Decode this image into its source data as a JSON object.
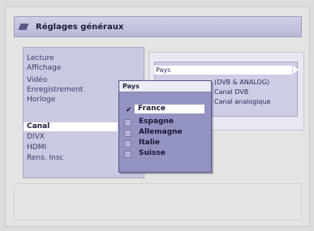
{
  "window": {
    "title": "Réglages généraux"
  },
  "sidebar": {
    "items": [
      {
        "label": "Lecture"
      },
      {
        "label": "Affichage"
      },
      {
        "label": "Vidéo"
      },
      {
        "label": "Enregistrement"
      },
      {
        "label": "Horloge"
      },
      {
        "label": "Canal"
      },
      {
        "label": "DIVX"
      },
      {
        "label": "HDMI"
      },
      {
        "label": "Rens. Insc"
      }
    ],
    "selected_index": 5
  },
  "panel": {
    "rows": [
      {
        "label": "Pays"
      },
      {
        "label": "(DVB & ANALOG)"
      },
      {
        "label": "Canal DVB"
      },
      {
        "label": "Canal analogique"
      }
    ]
  },
  "popup": {
    "title": "Pays",
    "options": [
      {
        "label": "France",
        "selected": true
      },
      {
        "label": "Espagne",
        "selected": false
      },
      {
        "label": "Allemagne",
        "selected": false
      },
      {
        "label": "Italie",
        "selected": false
      },
      {
        "label": "Suisse",
        "selected": false
      }
    ],
    "check_glyph": "✔"
  },
  "colors": {
    "background": "#dcdcda",
    "titlebar": "#b9b9d8",
    "sidebar": "#c9c9e2",
    "popup": "#9494c2",
    "highlight": "#ffffff"
  }
}
